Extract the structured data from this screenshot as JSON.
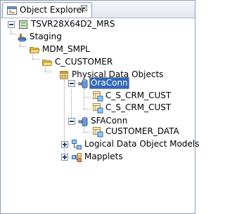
{
  "view": {
    "title": "Object Explorer",
    "close_glyph": "☒"
  },
  "tree": {
    "repository": {
      "label": "TSVR28X64D2_MRS",
      "icon": "repository-icon",
      "expanded": true
    },
    "project": {
      "label": "Staging",
      "icon": "project-icon",
      "expanded": true
    },
    "folder": {
      "label": "MDM_SMPL",
      "icon": "folder-icon",
      "expanded": true
    },
    "subfolder": {
      "label": "C_CUSTOMER",
      "icon": "folder-icon",
      "expanded": true
    },
    "physical_data_objects": {
      "label": "Physical Data Objects",
      "icon": "table-grid-icon",
      "expanded": true
    },
    "connections": [
      {
        "label": "OraConn",
        "icon": "database-connection-icon",
        "expanded": true,
        "selected": true,
        "children": [
          {
            "label": "C_S_CRM_CUST",
            "icon": "data-object-icon"
          },
          {
            "label": "C_S_CRM_CUST",
            "icon": "data-object-icon"
          }
        ]
      },
      {
        "label": "SFAConn",
        "icon": "database-connection-icon",
        "expanded": true,
        "selected": false,
        "children": [
          {
            "label": "CUSTOMER_DATA",
            "icon": "data-object-icon"
          }
        ]
      }
    ],
    "logical_models": {
      "label": "Logical Data Object Models",
      "icon": "logical-model-icon",
      "expanded": false
    },
    "mapplets": {
      "label": "Mapplets",
      "icon": "mapplet-icon",
      "expanded": false
    }
  },
  "colors": {
    "selection": "#3168b8",
    "folder": "#f0c040",
    "border": "#8f9fb8"
  }
}
